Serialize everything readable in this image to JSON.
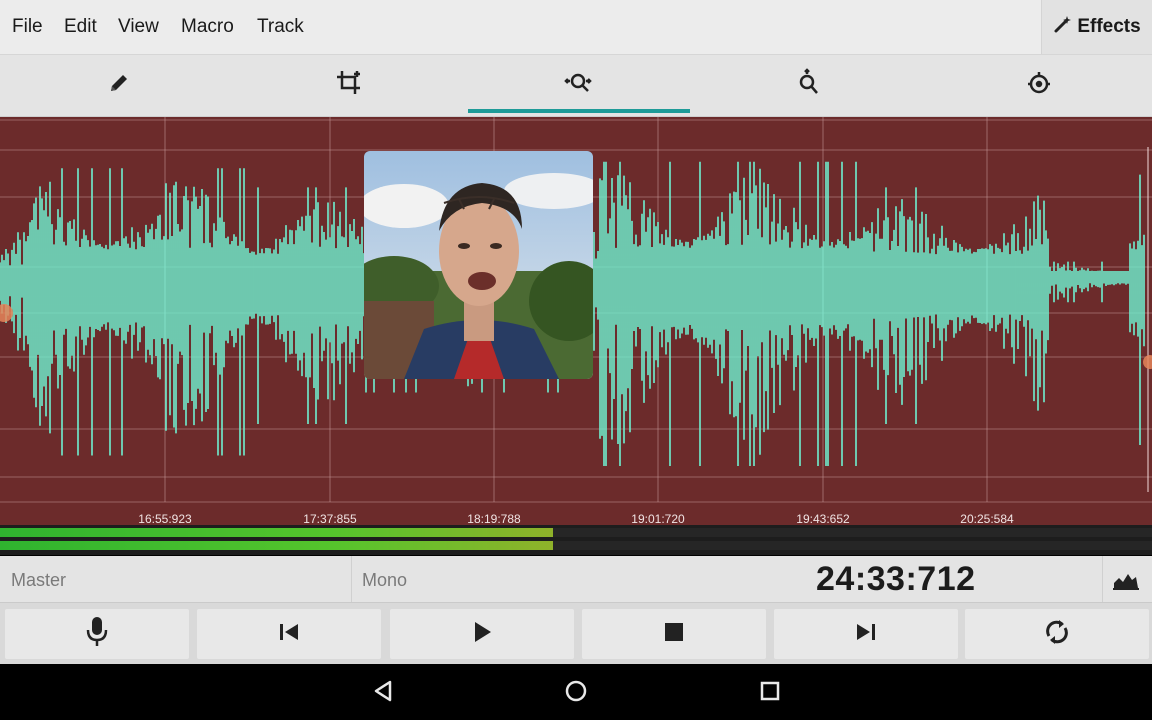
{
  "menu": {
    "file": "File",
    "edit": "Edit",
    "view": "View",
    "macro": "Macro",
    "track": "Track",
    "effects": "Effects"
  },
  "toolbar": {
    "tabs": [
      {
        "icon": "pencil-icon"
      },
      {
        "icon": "crop-icon"
      },
      {
        "icon": "zoom-horizontal-icon",
        "active": true
      },
      {
        "icon": "zoom-vertical-icon"
      },
      {
        "icon": "center-view-icon"
      }
    ]
  },
  "timeline": {
    "ticks": [
      "16:55:923",
      "17:37:855",
      "18:19:788",
      "19:01:720",
      "19:43:652",
      "20:25:584"
    ],
    "background_color": "#6c2b2b",
    "waveform_color": "#6ff0d0"
  },
  "levels": {
    "left": 0.48,
    "right": 0.48,
    "color": "#55c42c"
  },
  "info": {
    "track_name": "Master",
    "channel_mode": "Mono",
    "time": "24:33:712"
  },
  "transport": {
    "buttons": [
      "microphone-icon",
      "skip-back-icon",
      "play-icon",
      "stop-icon",
      "skip-forward-icon",
      "loop-icon"
    ]
  },
  "accent_color": "#1e9b98"
}
